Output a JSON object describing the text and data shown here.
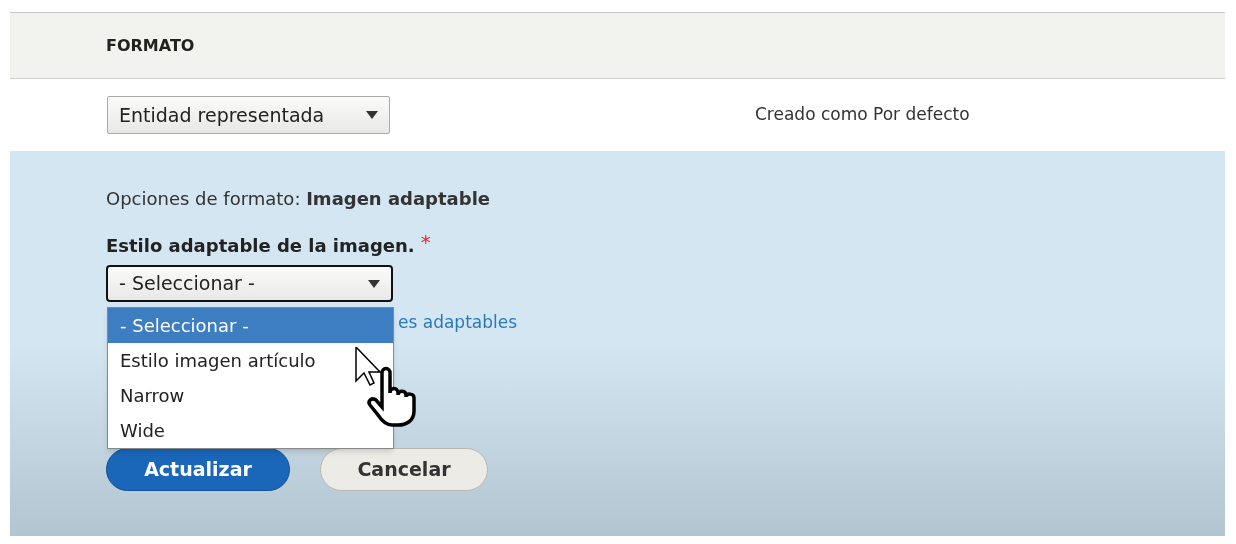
{
  "header": {
    "title": "FORMATO"
  },
  "format_select": {
    "value": "Entidad representada"
  },
  "status": "Creado como Por defecto",
  "settings": {
    "summary": "Opciones de formato: **Imagen adaptable**",
    "field_label": "Estilo adaptable de la imagen.",
    "required_mark": "*",
    "select": {
      "value": "- Seleccionar -",
      "expanded": true
    },
    "options": [
      {
        "label": "- Seleccionar -",
        "selected": true
      },
      {
        "label": "Estilo imagen artículo",
        "selected": false
      },
      {
        "label": "Narrow",
        "selected": false
      },
      {
        "label": "Wide",
        "selected": false
      }
    ],
    "link": "es adaptables"
  },
  "buttons": [
    {
      "label": "Actualizar",
      "kind": "primary"
    },
    {
      "label": "Cancelar",
      "kind": "secondary"
    }
  ]
}
